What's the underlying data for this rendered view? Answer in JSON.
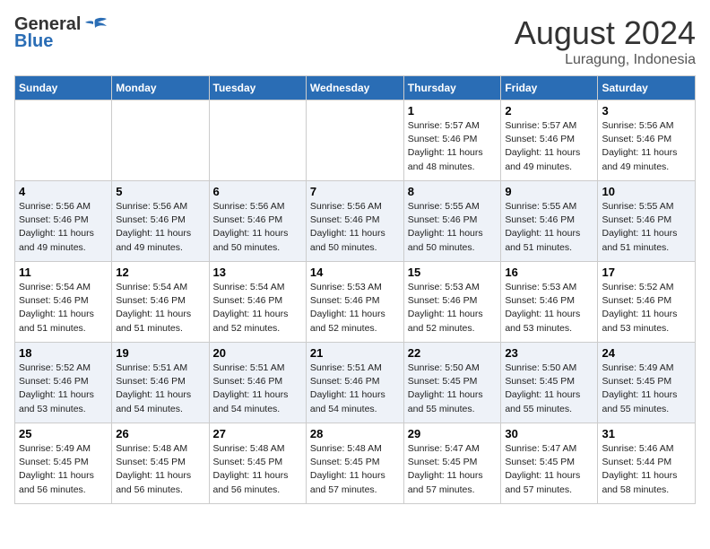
{
  "header": {
    "logo_general": "General",
    "logo_blue": "Blue",
    "month_year": "August 2024",
    "location": "Luragung, Indonesia"
  },
  "days_of_week": [
    "Sunday",
    "Monday",
    "Tuesday",
    "Wednesday",
    "Thursday",
    "Friday",
    "Saturday"
  ],
  "weeks": [
    [
      {
        "day": "",
        "info": ""
      },
      {
        "day": "",
        "info": ""
      },
      {
        "day": "",
        "info": ""
      },
      {
        "day": "",
        "info": ""
      },
      {
        "day": "1",
        "info": "Sunrise: 5:57 AM\nSunset: 5:46 PM\nDaylight: 11 hours\nand 48 minutes."
      },
      {
        "day": "2",
        "info": "Sunrise: 5:57 AM\nSunset: 5:46 PM\nDaylight: 11 hours\nand 49 minutes."
      },
      {
        "day": "3",
        "info": "Sunrise: 5:56 AM\nSunset: 5:46 PM\nDaylight: 11 hours\nand 49 minutes."
      }
    ],
    [
      {
        "day": "4",
        "info": "Sunrise: 5:56 AM\nSunset: 5:46 PM\nDaylight: 11 hours\nand 49 minutes."
      },
      {
        "day": "5",
        "info": "Sunrise: 5:56 AM\nSunset: 5:46 PM\nDaylight: 11 hours\nand 49 minutes."
      },
      {
        "day": "6",
        "info": "Sunrise: 5:56 AM\nSunset: 5:46 PM\nDaylight: 11 hours\nand 50 minutes."
      },
      {
        "day": "7",
        "info": "Sunrise: 5:56 AM\nSunset: 5:46 PM\nDaylight: 11 hours\nand 50 minutes."
      },
      {
        "day": "8",
        "info": "Sunrise: 5:55 AM\nSunset: 5:46 PM\nDaylight: 11 hours\nand 50 minutes."
      },
      {
        "day": "9",
        "info": "Sunrise: 5:55 AM\nSunset: 5:46 PM\nDaylight: 11 hours\nand 51 minutes."
      },
      {
        "day": "10",
        "info": "Sunrise: 5:55 AM\nSunset: 5:46 PM\nDaylight: 11 hours\nand 51 minutes."
      }
    ],
    [
      {
        "day": "11",
        "info": "Sunrise: 5:54 AM\nSunset: 5:46 PM\nDaylight: 11 hours\nand 51 minutes."
      },
      {
        "day": "12",
        "info": "Sunrise: 5:54 AM\nSunset: 5:46 PM\nDaylight: 11 hours\nand 51 minutes."
      },
      {
        "day": "13",
        "info": "Sunrise: 5:54 AM\nSunset: 5:46 PM\nDaylight: 11 hours\nand 52 minutes."
      },
      {
        "day": "14",
        "info": "Sunrise: 5:53 AM\nSunset: 5:46 PM\nDaylight: 11 hours\nand 52 minutes."
      },
      {
        "day": "15",
        "info": "Sunrise: 5:53 AM\nSunset: 5:46 PM\nDaylight: 11 hours\nand 52 minutes."
      },
      {
        "day": "16",
        "info": "Sunrise: 5:53 AM\nSunset: 5:46 PM\nDaylight: 11 hours\nand 53 minutes."
      },
      {
        "day": "17",
        "info": "Sunrise: 5:52 AM\nSunset: 5:46 PM\nDaylight: 11 hours\nand 53 minutes."
      }
    ],
    [
      {
        "day": "18",
        "info": "Sunrise: 5:52 AM\nSunset: 5:46 PM\nDaylight: 11 hours\nand 53 minutes."
      },
      {
        "day": "19",
        "info": "Sunrise: 5:51 AM\nSunset: 5:46 PM\nDaylight: 11 hours\nand 54 minutes."
      },
      {
        "day": "20",
        "info": "Sunrise: 5:51 AM\nSunset: 5:46 PM\nDaylight: 11 hours\nand 54 minutes."
      },
      {
        "day": "21",
        "info": "Sunrise: 5:51 AM\nSunset: 5:46 PM\nDaylight: 11 hours\nand 54 minutes."
      },
      {
        "day": "22",
        "info": "Sunrise: 5:50 AM\nSunset: 5:45 PM\nDaylight: 11 hours\nand 55 minutes."
      },
      {
        "day": "23",
        "info": "Sunrise: 5:50 AM\nSunset: 5:45 PM\nDaylight: 11 hours\nand 55 minutes."
      },
      {
        "day": "24",
        "info": "Sunrise: 5:49 AM\nSunset: 5:45 PM\nDaylight: 11 hours\nand 55 minutes."
      }
    ],
    [
      {
        "day": "25",
        "info": "Sunrise: 5:49 AM\nSunset: 5:45 PM\nDaylight: 11 hours\nand 56 minutes."
      },
      {
        "day": "26",
        "info": "Sunrise: 5:48 AM\nSunset: 5:45 PM\nDaylight: 11 hours\nand 56 minutes."
      },
      {
        "day": "27",
        "info": "Sunrise: 5:48 AM\nSunset: 5:45 PM\nDaylight: 11 hours\nand 56 minutes."
      },
      {
        "day": "28",
        "info": "Sunrise: 5:48 AM\nSunset: 5:45 PM\nDaylight: 11 hours\nand 57 minutes."
      },
      {
        "day": "29",
        "info": "Sunrise: 5:47 AM\nSunset: 5:45 PM\nDaylight: 11 hours\nand 57 minutes."
      },
      {
        "day": "30",
        "info": "Sunrise: 5:47 AM\nSunset: 5:45 PM\nDaylight: 11 hours\nand 57 minutes."
      },
      {
        "day": "31",
        "info": "Sunrise: 5:46 AM\nSunset: 5:44 PM\nDaylight: 11 hours\nand 58 minutes."
      }
    ]
  ]
}
